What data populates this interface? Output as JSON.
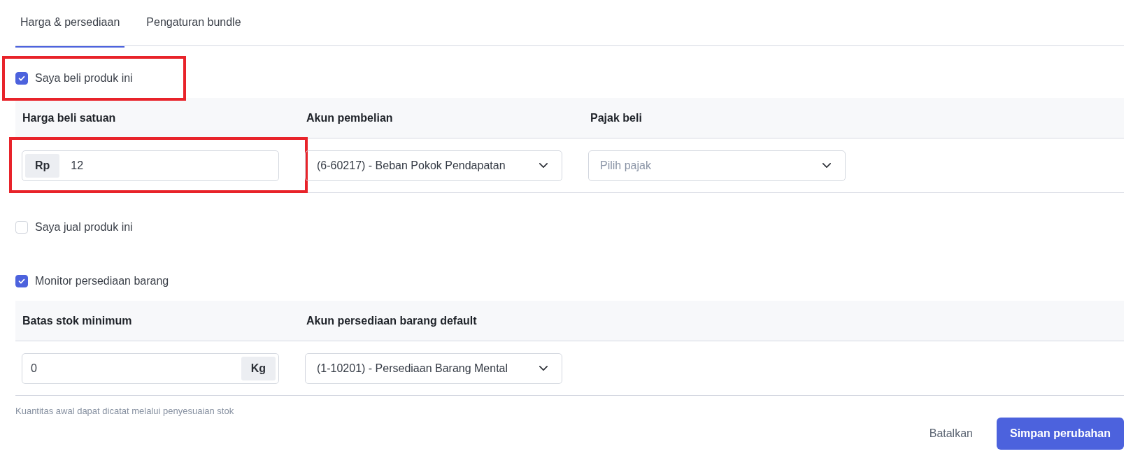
{
  "tabs": [
    {
      "label": "Harga & persediaan",
      "selected": true
    },
    {
      "label": "Pengaturan bundle",
      "selected": false
    }
  ],
  "options": [
    {
      "label": "Saya beli produk ini",
      "checked": true,
      "highlighted": true,
      "table": {
        "columns": [
          "Harga beli satuan",
          "Akun pembelian",
          "Pajak beli"
        ],
        "fields": [
          {
            "kind": "prefix",
            "affix": "Rp",
            "value": "12",
            "highlighted": true
          },
          {
            "kind": "select",
            "value": "(6-60217) - Beban Pokok Pendapatan"
          },
          {
            "kind": "select",
            "placeholder": "Pilih pajak"
          }
        ]
      }
    },
    {
      "label": "Saya jual produk ini",
      "checked": false,
      "highlighted": false
    },
    {
      "label": "Monitor persediaan barang",
      "checked": true,
      "highlighted": false,
      "table": {
        "columns": [
          "Batas stok minimum",
          "Akun persediaan barang default"
        ],
        "fields": [
          {
            "kind": "suffix",
            "affix": "Kg",
            "value": "0",
            "highlighted": false
          },
          {
            "kind": "select",
            "value": "(1-10201) - Persediaan Barang Mental"
          }
        ]
      }
    }
  ],
  "hint": "Kuantitas awal dapat dicatat melalui penyesuaian stok",
  "buttons": [
    {
      "label": "Batalkan",
      "kind": "text"
    },
    {
      "label": "Simpan perubahan",
      "kind": "primary"
    }
  ]
}
